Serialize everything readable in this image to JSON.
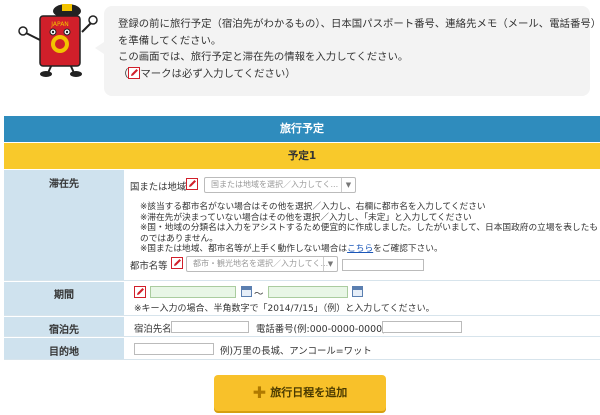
{
  "intro": {
    "lines": [
      "登録の前に旅行予定（宿泊先がわかるもの）、日本国パスポート番号、連絡先メモ（メール、電話番号）",
      "を準備してください。",
      "この画面では、旅行予定と滞在先の情報を入力してください。"
    ],
    "required_note_prefix": "（",
    "required_note_suffix": "マークは必ず入力してください）",
    "mascot_text": "JAPAN"
  },
  "section_title": "旅行予定",
  "plan_title": "予定1",
  "stay": {
    "label": "滞在先",
    "country_label": "国または地域",
    "country_placeholder": "国または地域を選択／入力してく...",
    "notes": [
      "※該当する都市名がない場合はその他を選択／入力し、右欄に都市名を入力してください",
      "※滞在先が決まっていない場合はその他を選択／入力し、「未定」と入力してください",
      "※国・地域の分類名は入力をアシストするため便宜的に作成しました。したがいまして、日本国政府の立場を表したものではありません。"
    ],
    "note_last_prefix": "※国または地域、都市名等が上手く動作しない場合は",
    "note_link": "こちら",
    "note_last_suffix": "をご確認下さい。",
    "city_label": "都市名等",
    "city_placeholder": "都市・観光地名を選択／入力してく..."
  },
  "period": {
    "label": "期間",
    "separator": "～",
    "note": "※キー入力の場合、半角数字で「2014/7/15」（例）と入力してください。"
  },
  "lodging": {
    "label": "宿泊先",
    "name_label": "宿泊先名",
    "phone_label": "電話番号(例:000-0000-0000)"
  },
  "purpose": {
    "label": "目的地",
    "example": "例)万里の長城、アンコール=ワット"
  },
  "add_button": "旅行日程を追加",
  "colors": {
    "header_blue": "#2f8cbd",
    "header_yellow": "#f8c92b",
    "label_bg": "#cfe2ee",
    "button": "#f8c12a"
  }
}
